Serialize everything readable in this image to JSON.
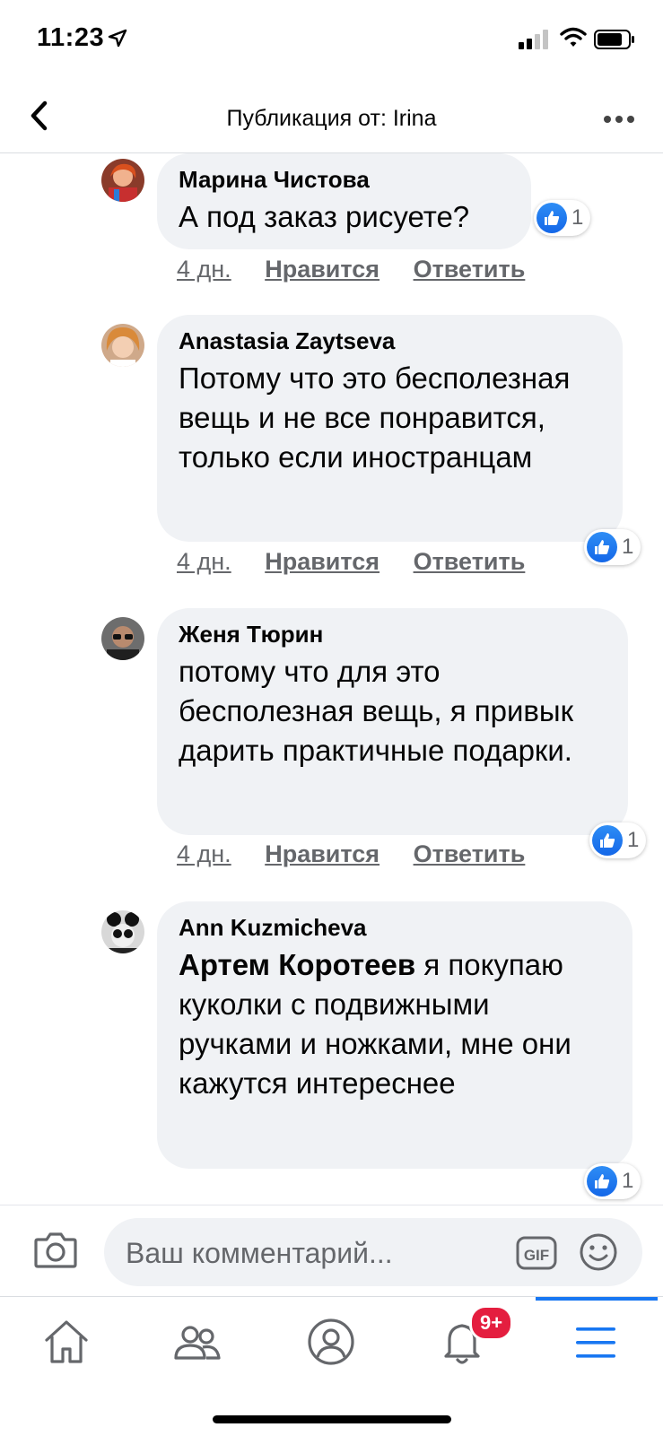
{
  "status_bar": {
    "time": "11:23"
  },
  "header": {
    "title": "Публикация от: Irina"
  },
  "comments": [
    {
      "author": "Марина Чистова",
      "text": "А под заказ рисуете?",
      "time": "4 дн.",
      "like_label": "Нравится",
      "reply_label": "Ответить",
      "reactions": "1"
    },
    {
      "author": "Anastasia Zaytseva",
      "text": "Потому что это бесполезная вещь и не все понравится, только если иностранцам",
      "time": "4 дн.",
      "like_label": "Нравится",
      "reply_label": "Ответить",
      "reactions": "1"
    },
    {
      "author": "Женя Тюрин",
      "text": "потому что для это бесполезная вещь, я привык дарить практичные подарки.",
      "time": "4 дн.",
      "like_label": "Нравится",
      "reply_label": "Ответить",
      "reactions": "1"
    },
    {
      "author": "Ann Kuzmicheva",
      "mention": "Артем Коротеев",
      "text": " я покупаю куколки с подвижными ручками и ножками, мне они кажутся интереснее",
      "reactions": "1"
    }
  ],
  "composer": {
    "placeholder": "Ваш комментарий..."
  },
  "tabbar": {
    "notifications_badge": "9+"
  },
  "colors": {
    "accent": "#1877f2",
    "bubble": "#f0f2f5",
    "badge": "#e41e3f"
  }
}
